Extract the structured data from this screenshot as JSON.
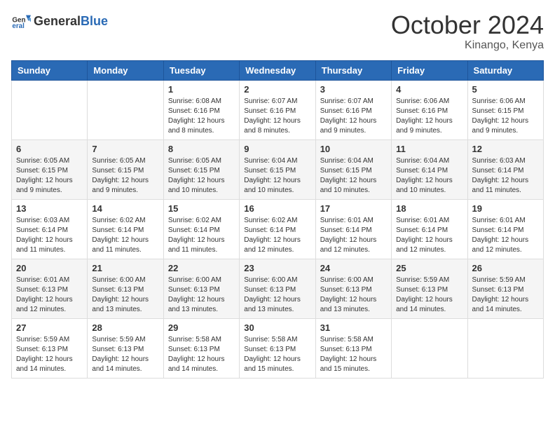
{
  "logo": {
    "general": "General",
    "blue": "Blue"
  },
  "header": {
    "month": "October 2024",
    "location": "Kinango, Kenya"
  },
  "weekdays": [
    "Sunday",
    "Monday",
    "Tuesday",
    "Wednesday",
    "Thursday",
    "Friday",
    "Saturday"
  ],
  "weeks": [
    [
      {
        "day": "",
        "info": ""
      },
      {
        "day": "",
        "info": ""
      },
      {
        "day": "1",
        "info": "Sunrise: 6:08 AM\nSunset: 6:16 PM\nDaylight: 12 hours and 8 minutes."
      },
      {
        "day": "2",
        "info": "Sunrise: 6:07 AM\nSunset: 6:16 PM\nDaylight: 12 hours and 8 minutes."
      },
      {
        "day": "3",
        "info": "Sunrise: 6:07 AM\nSunset: 6:16 PM\nDaylight: 12 hours and 9 minutes."
      },
      {
        "day": "4",
        "info": "Sunrise: 6:06 AM\nSunset: 6:16 PM\nDaylight: 12 hours and 9 minutes."
      },
      {
        "day": "5",
        "info": "Sunrise: 6:06 AM\nSunset: 6:15 PM\nDaylight: 12 hours and 9 minutes."
      }
    ],
    [
      {
        "day": "6",
        "info": "Sunrise: 6:05 AM\nSunset: 6:15 PM\nDaylight: 12 hours and 9 minutes."
      },
      {
        "day": "7",
        "info": "Sunrise: 6:05 AM\nSunset: 6:15 PM\nDaylight: 12 hours and 9 minutes."
      },
      {
        "day": "8",
        "info": "Sunrise: 6:05 AM\nSunset: 6:15 PM\nDaylight: 12 hours and 10 minutes."
      },
      {
        "day": "9",
        "info": "Sunrise: 6:04 AM\nSunset: 6:15 PM\nDaylight: 12 hours and 10 minutes."
      },
      {
        "day": "10",
        "info": "Sunrise: 6:04 AM\nSunset: 6:15 PM\nDaylight: 12 hours and 10 minutes."
      },
      {
        "day": "11",
        "info": "Sunrise: 6:04 AM\nSunset: 6:14 PM\nDaylight: 12 hours and 10 minutes."
      },
      {
        "day": "12",
        "info": "Sunrise: 6:03 AM\nSunset: 6:14 PM\nDaylight: 12 hours and 11 minutes."
      }
    ],
    [
      {
        "day": "13",
        "info": "Sunrise: 6:03 AM\nSunset: 6:14 PM\nDaylight: 12 hours and 11 minutes."
      },
      {
        "day": "14",
        "info": "Sunrise: 6:02 AM\nSunset: 6:14 PM\nDaylight: 12 hours and 11 minutes."
      },
      {
        "day": "15",
        "info": "Sunrise: 6:02 AM\nSunset: 6:14 PM\nDaylight: 12 hours and 11 minutes."
      },
      {
        "day": "16",
        "info": "Sunrise: 6:02 AM\nSunset: 6:14 PM\nDaylight: 12 hours and 12 minutes."
      },
      {
        "day": "17",
        "info": "Sunrise: 6:01 AM\nSunset: 6:14 PM\nDaylight: 12 hours and 12 minutes."
      },
      {
        "day": "18",
        "info": "Sunrise: 6:01 AM\nSunset: 6:14 PM\nDaylight: 12 hours and 12 minutes."
      },
      {
        "day": "19",
        "info": "Sunrise: 6:01 AM\nSunset: 6:14 PM\nDaylight: 12 hours and 12 minutes."
      }
    ],
    [
      {
        "day": "20",
        "info": "Sunrise: 6:01 AM\nSunset: 6:13 PM\nDaylight: 12 hours and 12 minutes."
      },
      {
        "day": "21",
        "info": "Sunrise: 6:00 AM\nSunset: 6:13 PM\nDaylight: 12 hours and 13 minutes."
      },
      {
        "day": "22",
        "info": "Sunrise: 6:00 AM\nSunset: 6:13 PM\nDaylight: 12 hours and 13 minutes."
      },
      {
        "day": "23",
        "info": "Sunrise: 6:00 AM\nSunset: 6:13 PM\nDaylight: 12 hours and 13 minutes."
      },
      {
        "day": "24",
        "info": "Sunrise: 6:00 AM\nSunset: 6:13 PM\nDaylight: 12 hours and 13 minutes."
      },
      {
        "day": "25",
        "info": "Sunrise: 5:59 AM\nSunset: 6:13 PM\nDaylight: 12 hours and 14 minutes."
      },
      {
        "day": "26",
        "info": "Sunrise: 5:59 AM\nSunset: 6:13 PM\nDaylight: 12 hours and 14 minutes."
      }
    ],
    [
      {
        "day": "27",
        "info": "Sunrise: 5:59 AM\nSunset: 6:13 PM\nDaylight: 12 hours and 14 minutes."
      },
      {
        "day": "28",
        "info": "Sunrise: 5:59 AM\nSunset: 6:13 PM\nDaylight: 12 hours and 14 minutes."
      },
      {
        "day": "29",
        "info": "Sunrise: 5:58 AM\nSunset: 6:13 PM\nDaylight: 12 hours and 14 minutes."
      },
      {
        "day": "30",
        "info": "Sunrise: 5:58 AM\nSunset: 6:13 PM\nDaylight: 12 hours and 15 minutes."
      },
      {
        "day": "31",
        "info": "Sunrise: 5:58 AM\nSunset: 6:13 PM\nDaylight: 12 hours and 15 minutes."
      },
      {
        "day": "",
        "info": ""
      },
      {
        "day": "",
        "info": ""
      }
    ]
  ]
}
